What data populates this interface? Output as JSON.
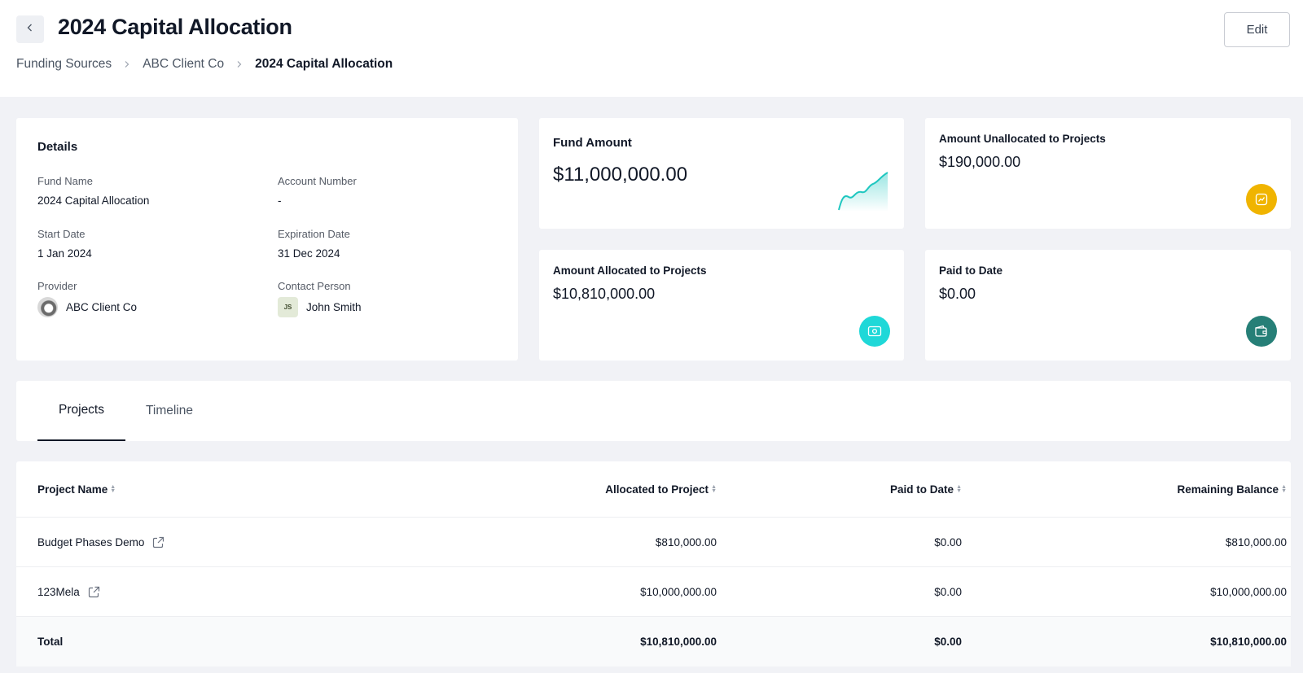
{
  "header": {
    "title": "2024 Capital Allocation",
    "edit_label": "Edit",
    "breadcrumb": [
      "Funding Sources",
      "ABC Client Co",
      "2024 Capital Allocation"
    ]
  },
  "details": {
    "title": "Details",
    "fields": {
      "fund_name": {
        "label": "Fund Name",
        "value": "2024 Capital Allocation"
      },
      "account_number": {
        "label": "Account Number",
        "value": "-"
      },
      "start_date": {
        "label": "Start Date",
        "value": "1 Jan 2024"
      },
      "expiration_date": {
        "label": "Expiration Date",
        "value": "31 Dec 2024"
      },
      "provider": {
        "label": "Provider",
        "value": "ABC Client Co"
      },
      "contact_person": {
        "label": "Contact Person",
        "value": "John Smith",
        "initials": "JS"
      }
    }
  },
  "stats": {
    "fund_amount": {
      "label": "Fund Amount",
      "value": "$11,000,000.00"
    },
    "unallocated": {
      "label": "Amount Unallocated to Projects",
      "value": "$190,000.00",
      "icon": "trend-icon",
      "color": "#f0b400"
    },
    "allocated": {
      "label": "Amount Allocated to Projects",
      "value": "$10,810,000.00",
      "icon": "cash-icon",
      "color": "#1fd8d8"
    },
    "paid": {
      "label": "Paid to Date",
      "value": "$0.00",
      "icon": "wallet-icon",
      "color": "#267f77"
    }
  },
  "tabs": [
    {
      "label": "Projects",
      "active": true
    },
    {
      "label": "Timeline",
      "active": false
    }
  ],
  "table": {
    "columns": [
      "Project Name",
      "Allocated to Project",
      "Paid to Date",
      "Remaining Balance"
    ],
    "rows": [
      {
        "name": "Budget Phases Demo",
        "allocated": "$810,000.00",
        "paid": "$0.00",
        "remaining": "$810,000.00"
      },
      {
        "name": "123Mela",
        "allocated": "$10,000,000.00",
        "paid": "$0.00",
        "remaining": "$10,000,000.00"
      }
    ],
    "total": {
      "label": "Total",
      "allocated": "$10,810,000.00",
      "paid": "$0.00",
      "remaining": "$10,810,000.00"
    }
  }
}
